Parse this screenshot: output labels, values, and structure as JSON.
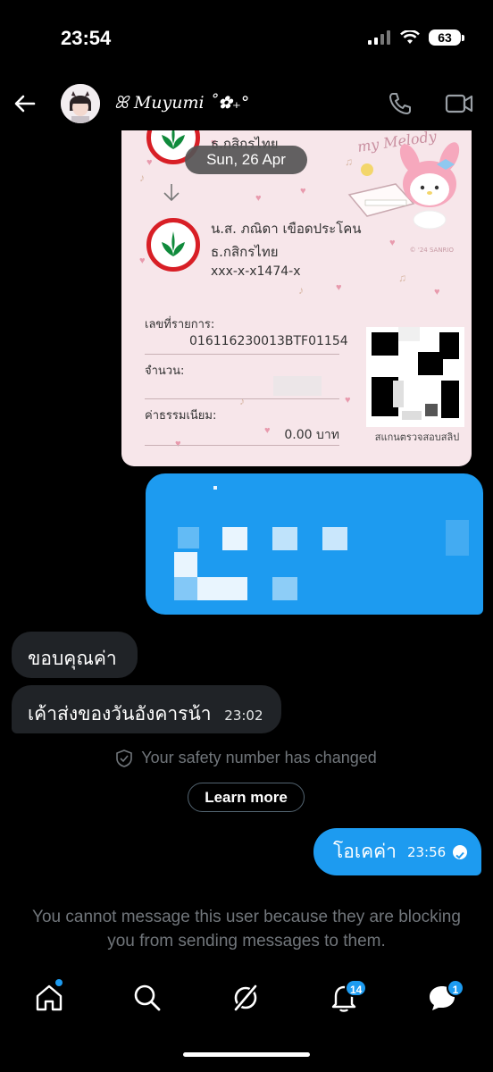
{
  "status_bar": {
    "time": "23:54",
    "battery": "63"
  },
  "header": {
    "contact_name": "ꕤ 𝑀𝑢𝑦𝑢𝑚𝑖 ˚✿₊°"
  },
  "slip": {
    "top_bank": "ธ.กสิกรไทย",
    "recipient_name": "น.ส. ภณิดา เขือดประโคน",
    "recipient_bank": "ธ.กสิกรไทย",
    "recipient_account": "xxx-x-x1474-x",
    "ref_label": "เลขที่รายการ:",
    "ref_value": "016116230013BTF01154",
    "amount_label": "จำนวน:",
    "fee_label": "ค่าธรรมเนียม:",
    "fee_value": "0.00 บาท",
    "qr_caption": "สแกนตรวจสอบสลิป",
    "watermark": "© '24 SANRIO",
    "decor_text": "my Melody"
  },
  "date_chip": "Sun, 26 Apr",
  "messages_in": [
    {
      "text": "ขอบคุณค่า",
      "time": ""
    },
    {
      "text": "เค้าส่งของวันอังคารน้า",
      "time": "23:02"
    }
  ],
  "safety_notice": "Your safety number has changed",
  "learn_more": "Learn more",
  "message_out": {
    "text": "โอเคค่า",
    "time": "23:56"
  },
  "blocked_notice": "You cannot message this user because they are blocking you from sending messages to them.",
  "nav": {
    "notifications_badge": "14",
    "messages_badge": "1"
  },
  "colors": {
    "accent": "#1d9bf0",
    "bubble_in": "#202327",
    "muted_text": "#71767b",
    "bank_green": "#0f8a3b",
    "bank_red": "#d81f26"
  }
}
